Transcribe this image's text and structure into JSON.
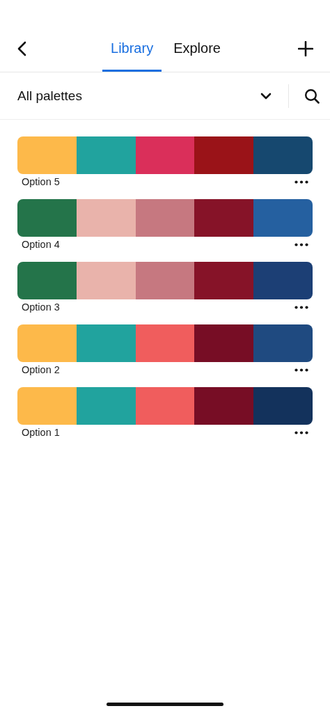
{
  "tabs": [
    {
      "label": "Library",
      "selected": true
    },
    {
      "label": "Explore",
      "selected": false
    }
  ],
  "filter": {
    "label": "All palettes"
  },
  "palettes": [
    {
      "name": "Option 5",
      "swatches": [
        {
          "color": "#fdb94a"
        },
        {
          "color": "#21a39e"
        },
        {
          "color": "#da2f5a"
        },
        {
          "color": "#9a1318"
        },
        {
          "color": "#16486f"
        }
      ]
    },
    {
      "name": "Option 4",
      "swatches": [
        {
          "color": "#24744a"
        },
        {
          "color": "#e9b3ab"
        },
        {
          "color": "#c67880"
        },
        {
          "color": "#861328"
        },
        {
          "color": "#2560a0"
        }
      ]
    },
    {
      "name": "Option 3",
      "swatches": [
        {
          "color": "#24744a"
        },
        {
          "color": "#e9b3ab"
        },
        {
          "color": "#c67880"
        },
        {
          "color": "#861328"
        },
        {
          "color": "#1c3f75"
        }
      ]
    },
    {
      "name": "Option 2",
      "swatches": [
        {
          "color": "#fdb94a"
        },
        {
          "color": "#21a39e"
        },
        {
          "color": "#f05d5d"
        },
        {
          "color": "#770d25"
        },
        {
          "color": "#1f4a80"
        }
      ]
    },
    {
      "name": "Option 1",
      "swatches": [
        {
          "color": "#fdb94a"
        },
        {
          "color": "#21a39e"
        },
        {
          "color": "#f05d5d"
        },
        {
          "color": "#770d25"
        },
        {
          "color": "#13325c"
        }
      ]
    }
  ]
}
